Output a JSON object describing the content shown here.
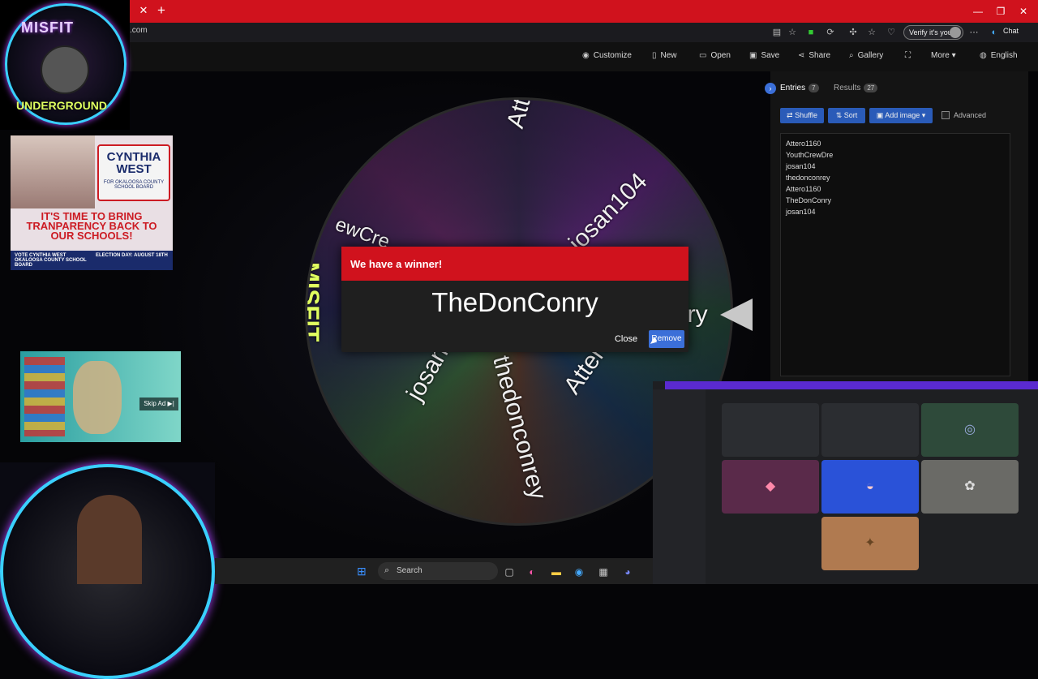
{
  "browser": {
    "url": ".com",
    "verify_label": "Verify it's you",
    "chat_label": "Chat"
  },
  "toolbar": {
    "customize": "Customize",
    "new": "New",
    "open": "Open",
    "save": "Save",
    "share": "Share",
    "gallery": "Gallery",
    "more": "More",
    "language": "English"
  },
  "wheel": {
    "labels": [
      "Attero1160",
      "josan104",
      "nry",
      "Attero1160",
      "thedonconrey",
      "josan104",
      "UNDERGROUND",
      "MISFIT",
      "ewCre"
    ]
  },
  "dialog": {
    "title": "We have a winner!",
    "winner": "TheDonConry",
    "close": "Close",
    "remove": "Remove"
  },
  "panel": {
    "tabs": {
      "entries": "Entries",
      "entries_count": "7",
      "results": "Results",
      "results_count": "27"
    },
    "buttons": {
      "shuffle": "Shuffle",
      "sort": "Sort",
      "add_image": "Add image",
      "advanced": "Advanced"
    },
    "entries": [
      "Attero1160",
      "YouthCrewDre",
      "josan104",
      "thedonconrey",
      "Attero1160",
      "TheDonConry",
      "josan104"
    ]
  },
  "overlay": {
    "logo_top": "MISFIT",
    "logo_bottom": "UNDERGROUND",
    "ad1": {
      "name": "CYNTHIA WEST",
      "sub": "FOR OKALOOSA COUNTY SCHOOL BOARD",
      "headline": "IT'S TIME TO BRING TRANPARENCY BACK TO OUR SCHOOLS!",
      "vote": "VOTE CYNTHIA WEST OKALOOSA COUNTY SCHOOL BOARD",
      "date": "ELECTION DAY: AUGUST 18TH"
    },
    "ad2": {
      "skip": "Skip Ad ▶|"
    }
  },
  "taskbar": {
    "search": "Search"
  },
  "colors": {
    "brand_red": "#d0121d",
    "button_blue": "#3b6fd8"
  }
}
